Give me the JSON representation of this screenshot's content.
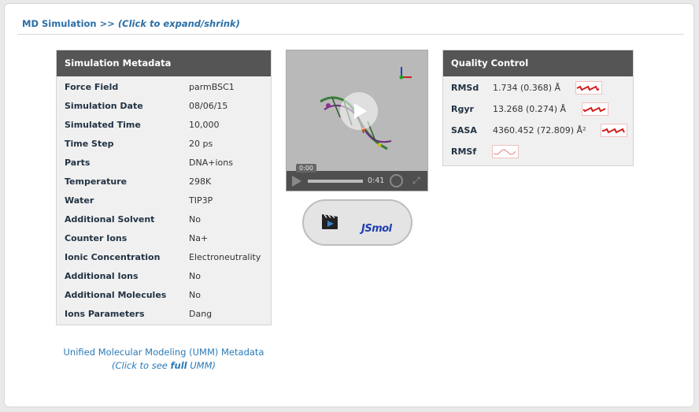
{
  "header": {
    "title": "MD Simulation >>",
    "hint": "(Click to expand/shrink)"
  },
  "metadata": {
    "title": "Simulation Metadata",
    "rows": [
      {
        "key": "Force Field",
        "value": "parmBSC1"
      },
      {
        "key": "Simulation Date",
        "value": "08/06/15"
      },
      {
        "key": "Simulated Time",
        "value": "10,000"
      },
      {
        "key": "Time Step",
        "value": "20 ps"
      },
      {
        "key": "Parts",
        "value": "DNA+ions"
      },
      {
        "key": "Temperature",
        "value": "298K"
      },
      {
        "key": "Water",
        "value": "TIP3P"
      },
      {
        "key": "Additional Solvent",
        "value": "No"
      },
      {
        "key": "Counter Ions",
        "value": "Na+"
      },
      {
        "key": "Ionic Concentration",
        "value": "Electroneutrality"
      },
      {
        "key": "Additional Ions",
        "value": "No"
      },
      {
        "key": "Additional Molecules",
        "value": "No"
      },
      {
        "key": "Ions Parameters",
        "value": "Dang"
      }
    ]
  },
  "umm": {
    "line1": "Unified Molecular Modeling (UMM) Metadata",
    "sub_pre": "(Click to see ",
    "sub_bold": "full",
    "sub_post": " UMM)"
  },
  "video": {
    "current_time": "0:00",
    "duration": "0:41",
    "progress": 0.0
  },
  "tools": {
    "movie_icon": "clapperboard-play-icon",
    "jsmol_logo": "JSmol"
  },
  "quality": {
    "title": "Quality Control",
    "rows": [
      {
        "key": "RMSd",
        "value": "1.734 (0.368) Å"
      },
      {
        "key": "Rgyr",
        "value": "13.268 (0.274) Å"
      },
      {
        "key": "SASA",
        "value": "4360.452 (72.809) Å²"
      },
      {
        "key": "RMSf",
        "value": ""
      }
    ]
  },
  "colors": {
    "header_bg": "#555555",
    "link": "#2a6fa8",
    "panel_bg": "#f0f0f0"
  }
}
